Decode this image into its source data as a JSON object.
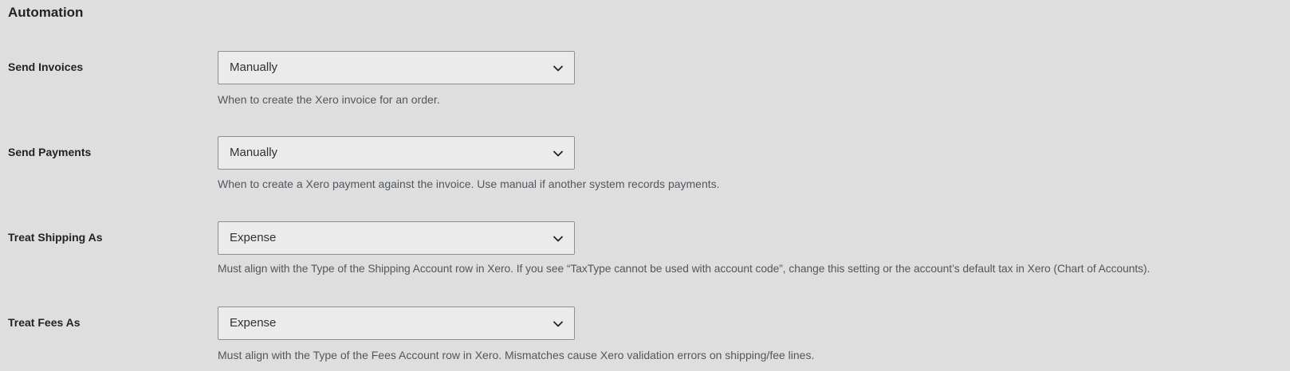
{
  "section": {
    "title": "Automation"
  },
  "settings": [
    {
      "label": "Send Invoices",
      "value": "Manually",
      "description": "When to create the Xero invoice for an order."
    },
    {
      "label": "Send Payments",
      "value": "Manually",
      "description": "When to create a Xero payment against the invoice. Use manual if another system records payments."
    },
    {
      "label": "Treat Shipping As",
      "value": "Expense",
      "description": "Must align with the Type of the Shipping Account row in Xero. If you see “TaxType cannot be used with account code”, change this setting or the account’s default tax in Xero (Chart of Accounts)."
    },
    {
      "label": "Treat Fees As",
      "value": "Expense",
      "description": "Must align with the Type of the Fees Account row in Xero. Mismatches cause Xero validation errors on shipping/fee lines."
    }
  ],
  "icons": {
    "dropdown": "chevron-down-icon"
  },
  "colors": {
    "background": "#dedede",
    "select_background": "#ebebeb",
    "select_border": "#8c8f94",
    "label_text": "#1d2327",
    "description_text": "#50575e"
  }
}
